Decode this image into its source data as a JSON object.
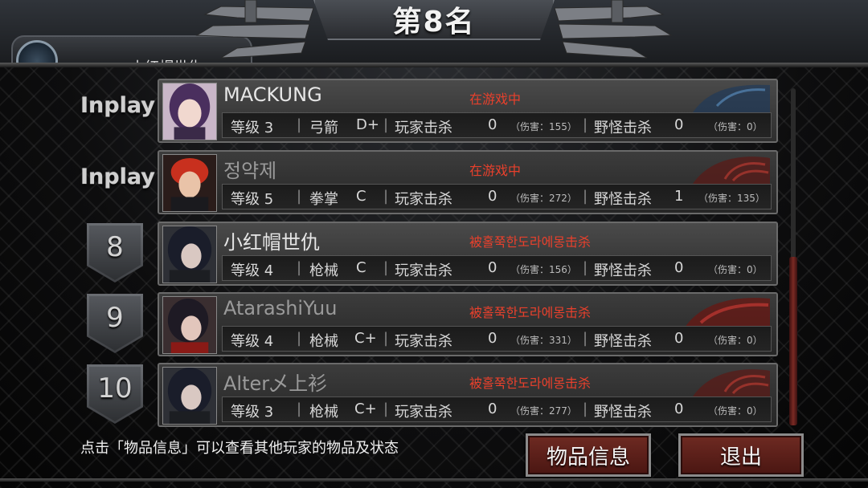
{
  "header": {
    "title": "第8名"
  },
  "player_tab": {
    "name": "小红帽世仇"
  },
  "rows": [
    {
      "rank_text": "Inplay",
      "rank_num": "",
      "name": "MACKUNG",
      "status": "在游戏中",
      "level": "等级 3",
      "weapon": "弓箭",
      "grade": "D+",
      "pk_label": "玩家击杀",
      "pk_count": "0",
      "pk_damage": "（伤害：155）",
      "mk_label": "野怪击杀",
      "mk_count": "0",
      "mk_damage": "（伤害：0）",
      "emblem": "blue-wolf"
    },
    {
      "rank_text": "Inplay",
      "rank_num": "",
      "name": "정약제",
      "status": "在游戏中",
      "level": "等级 5",
      "weapon": "拳掌",
      "grade": "C",
      "pk_label": "玩家击杀",
      "pk_count": "0",
      "pk_damage": "（伤害：272）",
      "mk_label": "野怪击杀",
      "mk_count": "1",
      "mk_damage": "（伤害：135）",
      "emblem": "red-phoenix"
    },
    {
      "rank_text": "",
      "rank_num": "8",
      "name": "小红帽世仇",
      "status": "被홀쭉한도라에몽击杀",
      "level": "等级 4",
      "weapon": "枪械",
      "grade": "C",
      "pk_label": "玩家击杀",
      "pk_count": "0",
      "pk_damage": "（伤害：156）",
      "mk_label": "野怪击杀",
      "mk_count": "0",
      "mk_damage": "（伤害：0）",
      "emblem": ""
    },
    {
      "rank_text": "",
      "rank_num": "9",
      "name": "AtarashiYuu",
      "status": "被홀쭉한도라에몽击杀",
      "level": "等级 4",
      "weapon": "枪械",
      "grade": "C+",
      "pk_label": "玩家击杀",
      "pk_count": "0",
      "pk_damage": "（伤害：331）",
      "mk_label": "野怪击杀",
      "mk_count": "0",
      "mk_damage": "（伤害：0）",
      "emblem": "red-dragon"
    },
    {
      "rank_text": "",
      "rank_num": "10",
      "name": "Alter乄上衫",
      "status": "被홀쭉한도라에몽击杀",
      "level": "等级 3",
      "weapon": "枪械",
      "grade": "C+",
      "pk_label": "玩家击杀",
      "pk_count": "0",
      "pk_damage": "（伤害：277）",
      "mk_label": "野怪击杀",
      "mk_count": "0",
      "mk_damage": "（伤害：0）",
      "emblem": "red-phoenix"
    }
  ],
  "footer": {
    "hint": "点击「物品信息」可以查看其他玩家的物品及状态",
    "items_button": "物品信息",
    "quit_button": "退出"
  },
  "colors": {
    "status_red": "#e8402c",
    "button_red": "#6e2a22"
  }
}
